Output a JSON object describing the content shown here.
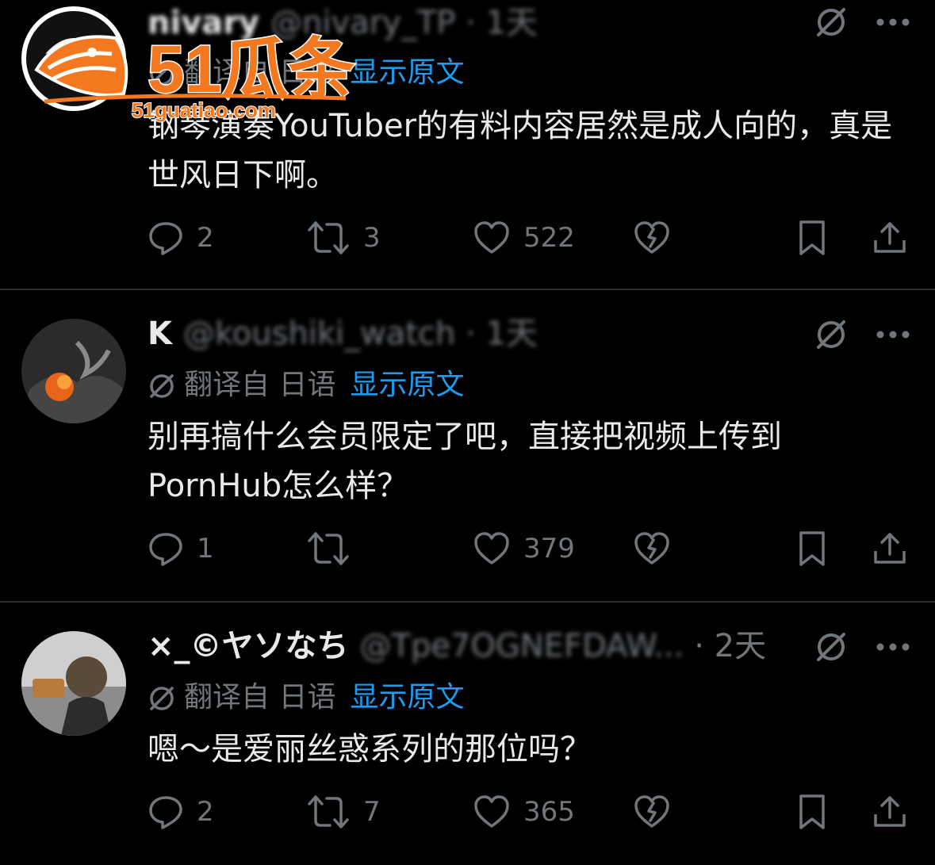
{
  "watermark": {
    "brand": "51瓜条",
    "url": "51guatiao.com"
  },
  "posts": [
    {
      "name": "nivary",
      "handle": "@nivary_TP",
      "time": "· 1天",
      "translate": {
        "from": "翻译自 日语",
        "show": "显示原文"
      },
      "text": "钢琴演奏YouTuber的有料内容居然是成人向的，真是世风日下啊。",
      "stats": {
        "replies": "2",
        "reposts": "3",
        "likes": "522"
      }
    },
    {
      "name": "K",
      "handle": "@koushiki_watch",
      "time": "· 1天",
      "translate": {
        "from": "翻译自 日语",
        "show": "显示原文"
      },
      "text": "别再搞什么会员限定了吧，直接把视频上传到PornHub怎么样？",
      "stats": {
        "replies": "1",
        "reposts": "",
        "likes": "379"
      }
    },
    {
      "name": "×_©ヤソなち",
      "handle": "@Tpe7OGNEFDAW...",
      "time": "· 2天",
      "translate": {
        "from": "翻译自 日语",
        "show": "显示原文"
      },
      "text": "嗯～是爱丽丝惑系列的那位吗？",
      "stats": {
        "replies": "2",
        "reposts": "7",
        "likes": "365"
      }
    }
  ],
  "colors": {
    "accent": "#1d9bf0",
    "muted": "#71767b",
    "text": "#e7e9ea",
    "logo": "#f4781f"
  },
  "icons": [
    "grok-icon",
    "more-icon",
    "translate-icon",
    "reply-icon",
    "repost-icon",
    "like-icon",
    "dislike-icon",
    "bookmark-icon",
    "share-icon"
  ]
}
